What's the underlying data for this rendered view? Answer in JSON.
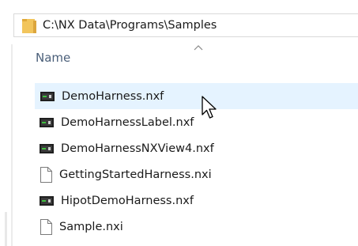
{
  "address_bar": {
    "path": "C:\\NX Data\\Programs\\Samples",
    "icon": "folder-icon",
    "folder_color": "#f2c55c"
  },
  "columns": {
    "name_label": "Name",
    "sort_indicator": "sort-ascending-caret-icon"
  },
  "files": [
    {
      "name": "DemoHarness.nxf",
      "type": "nxf",
      "icon": "nxf-file-icon",
      "hovered": true
    },
    {
      "name": "DemoHarnessLabel.nxf",
      "type": "nxf",
      "icon": "nxf-file-icon",
      "hovered": false
    },
    {
      "name": "DemoHarnessNXView4.nxf",
      "type": "nxf",
      "icon": "nxf-file-icon",
      "hovered": false
    },
    {
      "name": "GettingStartedHarness.nxi",
      "type": "nxi",
      "icon": "blank-document-icon",
      "hovered": false
    },
    {
      "name": "HipotDemoHarness.nxf",
      "type": "nxf",
      "icon": "nxf-file-icon",
      "hovered": false
    },
    {
      "name": "Sample.nxi",
      "type": "nxi",
      "icon": "blank-document-icon",
      "hovered": false
    }
  ],
  "colors": {
    "hover_highlight": "#e5f3ff",
    "header_text": "#4c607a"
  }
}
